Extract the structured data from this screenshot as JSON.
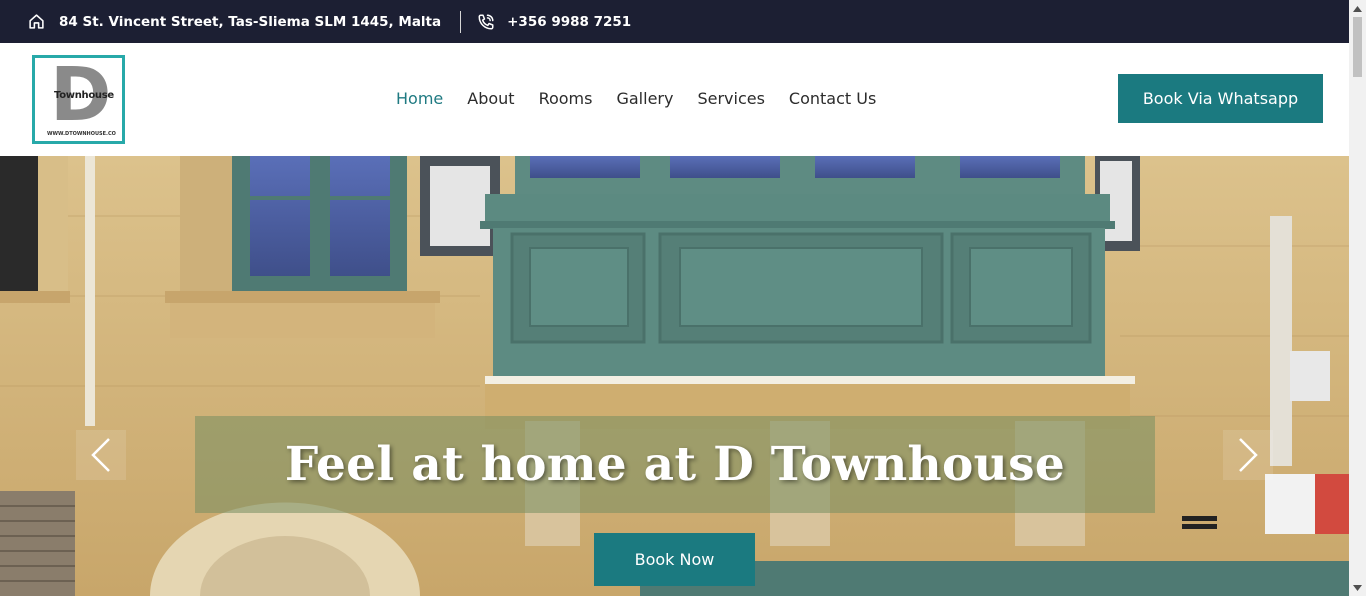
{
  "topbar": {
    "address": "84 St. Vincent Street, Tas-Sliema SLM 1445, Malta",
    "phone": "+356 9988 7251",
    "address_icon": "home-icon",
    "phone_icon": "phone-icon"
  },
  "logo": {
    "letter": "D",
    "word": "Townhouse",
    "url": "WWW.DTOWNHOUSE.CO"
  },
  "nav": {
    "items": [
      {
        "label": "Home",
        "active": true
      },
      {
        "label": "About"
      },
      {
        "label": "Rooms"
      },
      {
        "label": "Gallery"
      },
      {
        "label": "Services"
      },
      {
        "label": "Contact Us"
      }
    ]
  },
  "header": {
    "cta_label": "Book Via Whatsapp"
  },
  "hero": {
    "title": "Feel at home at D Townhouse",
    "button_label": "Book Now",
    "prev_icon": "chevron-left-icon",
    "next_icon": "chevron-right-icon"
  },
  "colors": {
    "topbar_bg": "#1c1f33",
    "accent": "#1b7a80",
    "logo_border": "#27a9a9",
    "nav_active": "#1f7a82"
  }
}
